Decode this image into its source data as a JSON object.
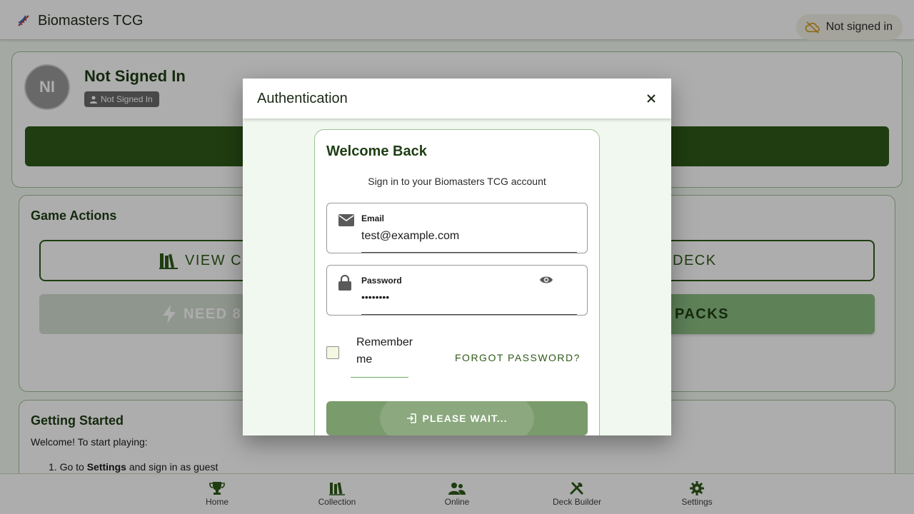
{
  "app": {
    "title": "Biomasters TCG",
    "logo_icon": "dna-icon",
    "status": {
      "label": "Not signed in",
      "icon": "cloud-off-icon"
    }
  },
  "profile": {
    "initials": "NI",
    "name": "Not Signed In",
    "badge": "Not Signed In"
  },
  "game_actions": {
    "heading": "Game Actions",
    "view_collection": "VIEW CO",
    "build_deck": "D DECK",
    "need_packs": "NEED 8",
    "open_packs": "PACKS"
  },
  "getting_started": {
    "heading": "Getting Started",
    "intro": "Welcome! To start playing:",
    "step1_prefix": "1. Go to ",
    "step1_strong": "Settings",
    "step1_suffix": " and sign in as guest"
  },
  "bottom_nav": [
    {
      "label": "Home",
      "icon": "trophy-icon"
    },
    {
      "label": "Collection",
      "icon": "library-icon"
    },
    {
      "label": "Online",
      "icon": "people-icon"
    },
    {
      "label": "Deck Builder",
      "icon": "tools-icon"
    },
    {
      "label": "Settings",
      "icon": "gear-icon"
    }
  ],
  "dialog": {
    "title": "Authentication",
    "close_icon": "close-icon",
    "card_title": "Welcome Back",
    "subtitle": "Sign in to your Biomasters TCG account",
    "email": {
      "label": "Email",
      "value": "test@example.com",
      "icon": "mail-icon"
    },
    "password": {
      "label": "Password",
      "value": "••••••••",
      "icon": "lock-icon",
      "toggle_icon": "eye-icon"
    },
    "remember_label": "Remember me",
    "remember_checked": false,
    "forgot_label": "FORGOT PASSWORD?",
    "submit_label": "PLEASE WAIT...",
    "submit_icon": "login-icon"
  },
  "colors": {
    "primary": "#2f5a18",
    "card_border": "#9fc095",
    "secondary_button": "#8bbf82",
    "submit_disabled": "#7a9b6b",
    "background": "#f4faf2"
  }
}
